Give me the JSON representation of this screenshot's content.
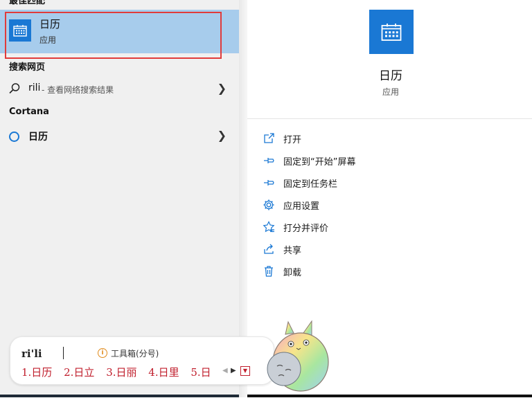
{
  "left_pane": {
    "best_match": {
      "section_title": "最佳匹配",
      "app_name": "日历",
      "app_type": "应用",
      "icon": "calendar-icon"
    },
    "web_search": {
      "section_title": "搜索网页",
      "query": "rili",
      "hint": " - 查看网络搜索结果",
      "icon": "search-icon"
    },
    "cortana": {
      "section_title": "Cortana",
      "label": "日历"
    }
  },
  "right_pane": {
    "app_name": "日历",
    "app_type": "应用",
    "actions": [
      {
        "label": "打开",
        "icon": "open-icon"
      },
      {
        "label": "固定到“开始”屏幕",
        "icon": "pin-icon"
      },
      {
        "label": "固定到任务栏",
        "icon": "pin-icon"
      },
      {
        "label": "应用设置",
        "icon": "gear-icon"
      },
      {
        "label": "打分并评价",
        "icon": "star-icon"
      },
      {
        "label": "共享",
        "icon": "share-icon"
      },
      {
        "label": "卸载",
        "icon": "trash-icon"
      }
    ]
  },
  "ime": {
    "input": "ri'li",
    "toolbox_label": "工具箱(分号)",
    "candidates": [
      "1.日历",
      "2.日立",
      "3.日丽",
      "4.日里",
      "5.日"
    ]
  },
  "colors": {
    "accent": "#1a78d4",
    "selection": "#a7ccec",
    "highlight_outline": "#e13b3b",
    "ime_candidate": "#c01e2c"
  }
}
